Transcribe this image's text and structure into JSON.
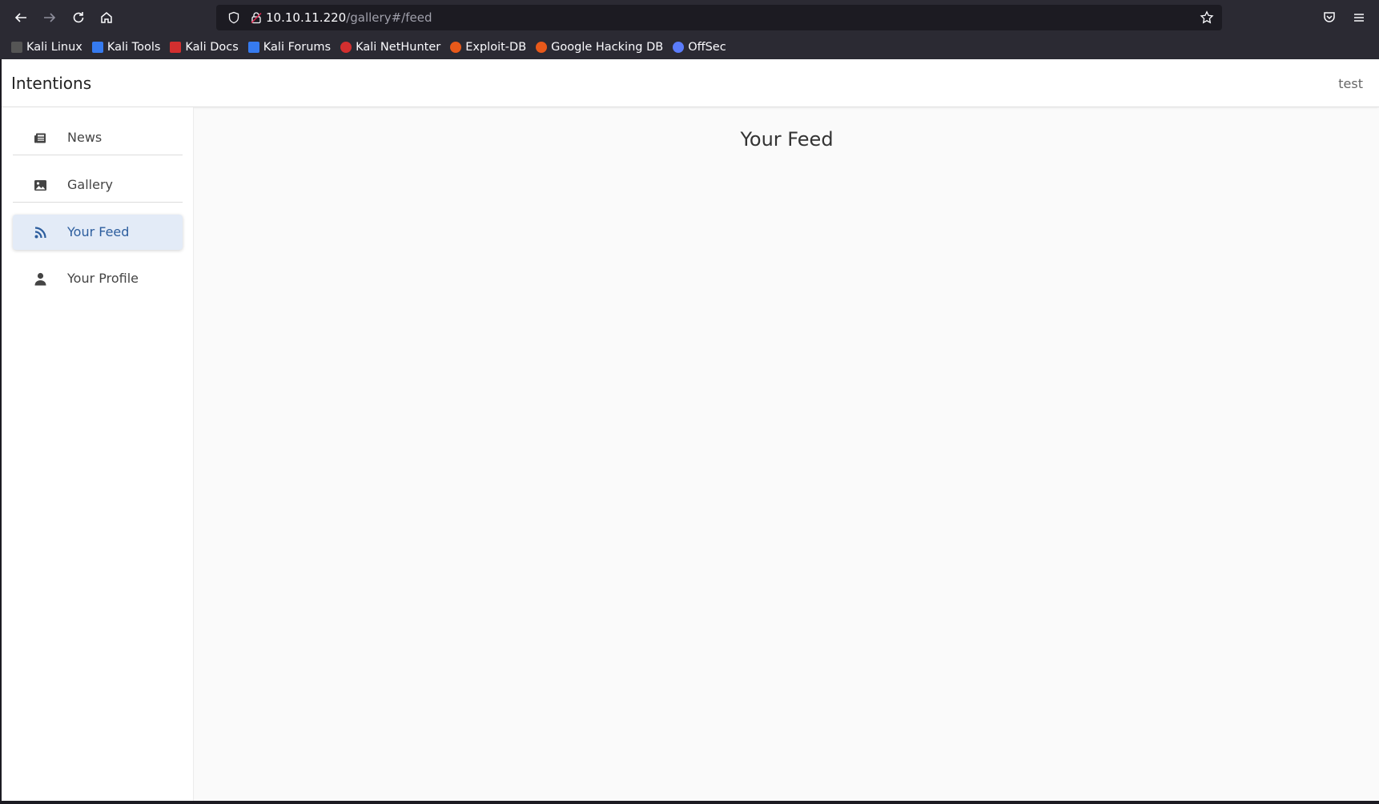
{
  "browser": {
    "url_host": "10.10.11.220",
    "url_path": "/gallery#/feed",
    "bookmarks": [
      {
        "label": "Kali Linux",
        "color": "#3b3b3b"
      },
      {
        "label": "Kali Tools",
        "color": "#367bf0"
      },
      {
        "label": "Kali Docs",
        "color": "#d32f2f"
      },
      {
        "label": "Kali Forums",
        "color": "#367bf0"
      },
      {
        "label": "Kali NetHunter",
        "color": "#d32f2f"
      },
      {
        "label": "Exploit-DB",
        "color": "#e8591a"
      },
      {
        "label": "Google Hacking DB",
        "color": "#e8591a"
      },
      {
        "label": "OffSec",
        "color": "#5b7cfa"
      }
    ]
  },
  "app": {
    "brand": "Intentions",
    "user": "test"
  },
  "sidebar": {
    "items": [
      {
        "label": "News",
        "icon": "newspaper-icon"
      },
      {
        "label": "Gallery",
        "icon": "image-icon"
      },
      {
        "label": "Your Feed",
        "icon": "rss-icon",
        "active": true
      },
      {
        "label": "Your Profile",
        "icon": "user-icon"
      }
    ]
  },
  "main": {
    "title": "Your Feed"
  },
  "colors": {
    "active_bg": "#e3ebf7",
    "active_text": "#2d5e9e"
  }
}
